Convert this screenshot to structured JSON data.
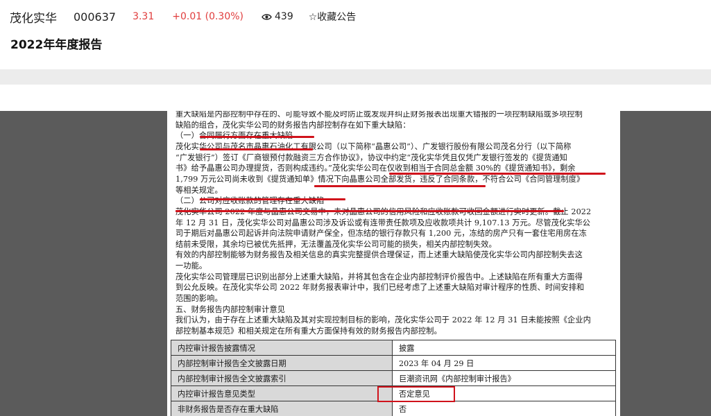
{
  "header": {
    "stock_name": "茂化实华",
    "stock_code": "000637",
    "price": "3.31",
    "change": "+0.01 (0.30%)",
    "views": "439",
    "favorite_label": "☆收藏公告",
    "eye_icon": "eye-icon",
    "accent_color": "#e03c3c"
  },
  "title": "2022年年度报告",
  "document": {
    "lines": [
      "重大缺陷是内部控制中存在的、可能导致不能及时防止或发现并纠正财务报表出现重大错报的一项控制缺陷或多项控制",
      "缺陷的组合，茂化实华公司的财务报告内部控制存在如下重大缺陷：",
      "（一）合同履行方面存在重大缺陷",
      "茂化实华公司与茂名市晶惠石油化工有限公司（以下简称“晶惠公司”）、广发银行股份有限公司茂名分行（以下简称",
      "“广发银行”）签订《厂商银预付款融资三方合作协议》，协议中约定“茂化实华凭且仅凭广发银行签发的《提货通知",
      "书》给予晶惠公司办理提货，否则构成违约。”茂化实华公司在仅收到相当于合同总金额 30%的《提货通知书》，剩余",
      "1,799 万元公司尚未收到《提货通知单》情况下向晶惠公司全部发货，违反了合同条款，不符合公司《合同管理制度》",
      "等相关规定。",
      "（二）公司对应收账款的管理存在重大缺陷",
      "茂化实华公司 2022 年度与晶惠公司交易中，未对晶惠公司的信用风险和应收账款可收回金额进行实时更新。截止 2022",
      "年 12 月 31 日，茂化实华公司对晶惠公司涉及诉讼或有连带责任款项及应收款项共计 9,107.13 万元。尽管茂化实华公",
      "司于期后对晶惠公司起诉并向法院申请财产保全，但冻结的银行存款只有 1,200 元，冻结的房产只有一套住宅用房在冻",
      "结前未受限，其余均已被优先抵押，无法覆盖茂化实华公司可能的损失，相关内部控制失效。",
      "有效的内部控制能够为财务报告及相关信息的真实完整提供合理保证，而上述重大缺陷使茂化实华公司内部控制失去这",
      "一功能。",
      "茂化实华公司管理层已识别出部分上述重大缺陷，并将其包含在企业内部控制评价报告中。上述缺陷在所有重大方面得",
      "到公允反映。在茂化实华公司 2022 年财务报表审计中，我们已经考虑了上述重大缺陷对审计程序的性质、时间安排和",
      "范围的影响。",
      "五、财务报告内部控制审计意见",
      "我们认为，由于存在上述重大缺陷及其对实现控制目标的影响，茂化实华公司于 2022 年 12 月 31 日未能按照《企业内",
      "部控制基本规范》和相关规定在所有重大方面保持有效的财务报告内部控制。"
    ],
    "table": [
      {
        "key": "内控审计报告披露情况",
        "value": "披露"
      },
      {
        "key": "内部控制审计报告全文披露日期",
        "value": "2023 年 04 月 29 日"
      },
      {
        "key": "内部控制审计报告全文披露索引",
        "value": "巨潮资讯网《内部控制审计报告》"
      },
      {
        "key": "内控审计报告意见类型",
        "value": "否定意见"
      },
      {
        "key": "非财务报告是否存在重大缺陷",
        "value": "否"
      }
    ],
    "highlight_color": "#d0121b"
  }
}
